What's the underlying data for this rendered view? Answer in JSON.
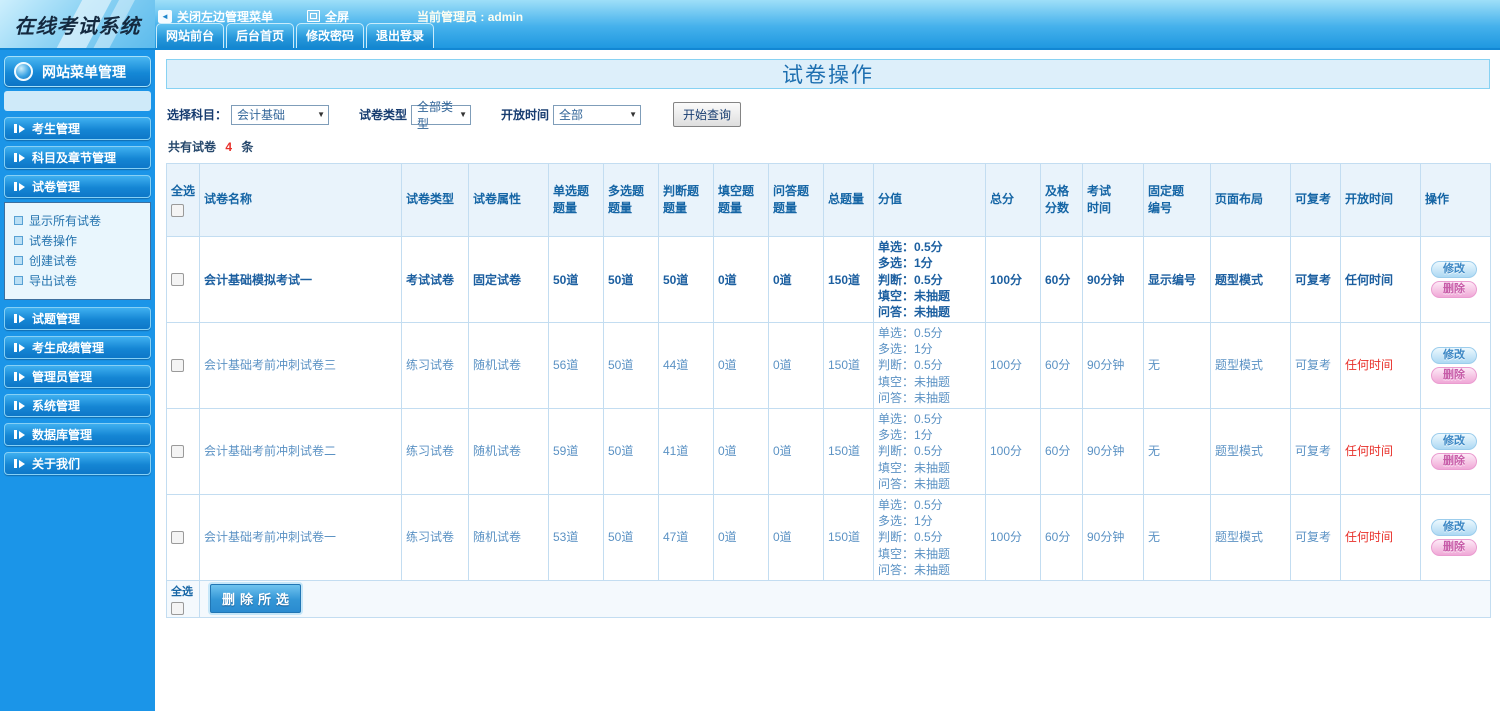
{
  "header": {
    "logo_text": "在线考试系统",
    "close_menu_label": "关闭左边管理菜单",
    "fullscreen_label": "全屏",
    "admin_label": "当前管理员 : admin",
    "tabs": [
      {
        "label": "网站前台"
      },
      {
        "label": "后台首页"
      },
      {
        "label": "修改密码"
      },
      {
        "label": "退出登录"
      }
    ]
  },
  "sidebar": {
    "title": "网站菜单管理",
    "menus_top": [
      {
        "label": "考生管理"
      },
      {
        "label": "科目及章节管理"
      },
      {
        "label": "试卷管理"
      }
    ],
    "submenu": [
      {
        "label": "显示所有试卷"
      },
      {
        "label": "试卷操作"
      },
      {
        "label": "创建试卷"
      },
      {
        "label": "导出试卷"
      }
    ],
    "menus_bottom": [
      {
        "label": "试题管理"
      },
      {
        "label": "考生成绩管理"
      },
      {
        "label": "管理员管理"
      },
      {
        "label": "系统管理"
      },
      {
        "label": "数据库管理"
      },
      {
        "label": "关于我们"
      }
    ]
  },
  "main": {
    "page_title": "试卷操作",
    "filters": {
      "subject_label": "选择科目：",
      "subject_value": "会计基础",
      "type_label": "试卷类型",
      "type_value": "全部类型",
      "time_label": "开放时间",
      "time_value": "全部",
      "search_button": "开始查询"
    },
    "summary": {
      "prefix": "共有试卷",
      "count": "4",
      "suffix": "条"
    },
    "table": {
      "columns": [
        "全选",
        "试卷名称",
        "试卷类型",
        "试卷属性",
        "单选题\n题量",
        "多选题\n题量",
        "判断题\n题量",
        "填空题\n题量",
        "问答题\n题量",
        "总题量",
        "分值",
        "总分",
        "及格\n分数",
        "考试\n时间",
        "固定题\n编号",
        "页面布局",
        "可复考",
        "开放时间",
        "操作"
      ],
      "action_edit": "修改",
      "action_delete": "删除",
      "rows": [
        {
          "name": "会计基础模拟考试一",
          "type": "考试试卷",
          "attr": "固定试卷",
          "q_single": "50道",
          "q_multi": "50道",
          "q_judge": "50道",
          "q_blank": "0道",
          "q_qa": "0道",
          "q_total": "150道",
          "score": "单选：0.5分\n多选：1分\n判断：0.5分\n填空：未抽题\n问答：未抽题",
          "score_total": "100分",
          "score_pass": "60分",
          "duration": "90分钟",
          "fixed_no": "显示编号",
          "layout": "题型模式",
          "retake": "可复考",
          "open_time": "任何时间"
        },
        {
          "name": "会计基础考前冲刺试卷三",
          "type": "练习试卷",
          "attr": "随机试卷",
          "q_single": "56道",
          "q_multi": "50道",
          "q_judge": "44道",
          "q_blank": "0道",
          "q_qa": "0道",
          "q_total": "150道",
          "score": "单选：0.5分\n多选：1分\n判断：0.5分\n填空：未抽题\n问答：未抽题",
          "score_total": "100分",
          "score_pass": "60分",
          "duration": "90分钟",
          "fixed_no": "无",
          "layout": "题型模式",
          "retake": "可复考",
          "open_time": "任何时间"
        },
        {
          "name": "会计基础考前冲刺试卷二",
          "type": "练习试卷",
          "attr": "随机试卷",
          "q_single": "59道",
          "q_multi": "50道",
          "q_judge": "41道",
          "q_blank": "0道",
          "q_qa": "0道",
          "q_total": "150道",
          "score": "单选：0.5分\n多选：1分\n判断：0.5分\n填空：未抽题\n问答：未抽题",
          "score_total": "100分",
          "score_pass": "60分",
          "duration": "90分钟",
          "fixed_no": "无",
          "layout": "题型模式",
          "retake": "可复考",
          "open_time": "任何时间"
        },
        {
          "name": "会计基础考前冲刺试卷一",
          "type": "练习试卷",
          "attr": "随机试卷",
          "q_single": "53道",
          "q_multi": "50道",
          "q_judge": "47道",
          "q_blank": "0道",
          "q_qa": "0道",
          "q_total": "150道",
          "score": "单选：0.5分\n多选：1分\n判断：0.5分\n填空：未抽题\n问答：未抽题",
          "score_total": "100分",
          "score_pass": "60分",
          "duration": "90分钟",
          "fixed_no": "无",
          "layout": "题型模式",
          "retake": "可复考",
          "open_time": "任何时间"
        }
      ]
    },
    "footer": {
      "select_all": "全选",
      "delete_button": "删除所选"
    }
  },
  "colors": {
    "accent_blue": "#1287d3",
    "table_header_text": "#1565a5",
    "status_red": "#e8302a",
    "edit_pill": "#aed9f3",
    "delete_pill": "#f0a8d7"
  }
}
